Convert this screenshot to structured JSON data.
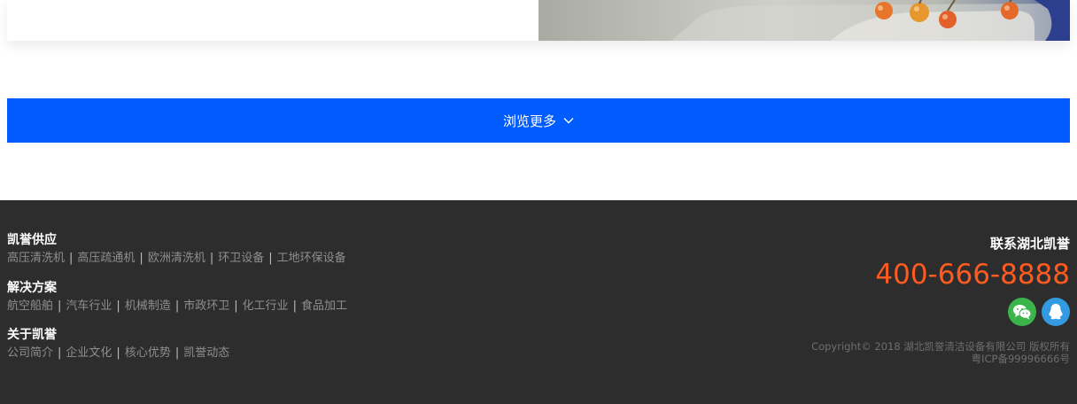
{
  "more_button": {
    "label": "浏览更多"
  },
  "footer": {
    "sections": [
      {
        "title": "凯誉供应",
        "links": [
          "高压清洗机",
          "高压疏通机",
          "欧洲清洗机",
          "环卫设备",
          "工地环保设备"
        ]
      },
      {
        "title": "解决方案",
        "links": [
          "航空船舶",
          "汽车行业",
          "机械制造",
          "市政环卫",
          "化工行业",
          "食品加工"
        ]
      },
      {
        "title": "关于凯誉",
        "links": [
          "公司简介",
          "企业文化",
          "核心优势",
          "凯誉动态"
        ]
      }
    ],
    "contact_title": "联系湖北凯誉",
    "phone": "400-666-8888",
    "socials": [
      {
        "icon": "wechat-icon",
        "color": "#3bb54a"
      },
      {
        "icon": "qq-icon",
        "color": "#3399e0"
      }
    ],
    "copyright": "Copyright© 2018 湖北凯誉清洁设备有限公司 版权所有",
    "icp": "粤ICP备99996666号"
  },
  "colors": {
    "button": "#005cff",
    "footer_bg": "#2d2d2d",
    "phone": "#ff5a1f"
  }
}
